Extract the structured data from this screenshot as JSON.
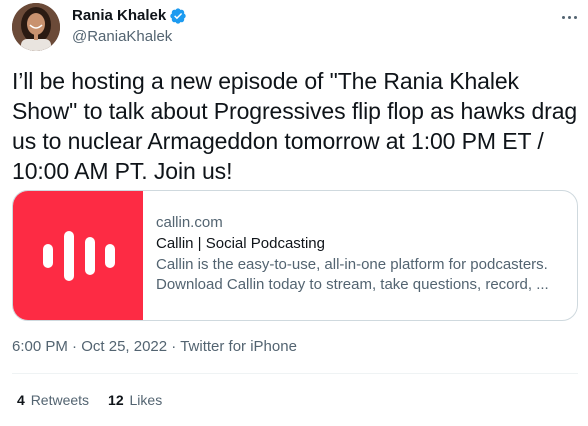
{
  "author": {
    "display_name": "Rania Khalek",
    "handle": "@RaniaKhalek",
    "verified": true,
    "avatar_icon": "profile-photo"
  },
  "tweet": {
    "text": "I’ll be hosting a new episode of \"The Rania Khalek Show\" to talk about Progressives flip flop as hawks drag us to nuclear Armageddon tomorrow at 1:00 PM ET / 10:00 AM PT. Join us!"
  },
  "card": {
    "domain": "callin.com",
    "title": "Callin | Social Podcasting",
    "description": "Callin is the easy-to-use, all-in-one platform for podcasters. Download Callin today to stream, take questions, record, ...",
    "brand_color": "#fd2b44",
    "logo_icon": "callin-waveform-logo"
  },
  "meta": {
    "time": "6:00 PM",
    "date": "Oct 25, 2022",
    "separator": "·",
    "source": "Twitter for iPhone"
  },
  "stats": {
    "retweets_count": "4",
    "retweets_label": "Retweets",
    "likes_count": "12",
    "likes_label": "Likes"
  },
  "colors": {
    "text_primary": "#0f1419",
    "text_secondary": "#536471",
    "verified_blue": "#1d9bf0",
    "border": "#cfd9de"
  }
}
